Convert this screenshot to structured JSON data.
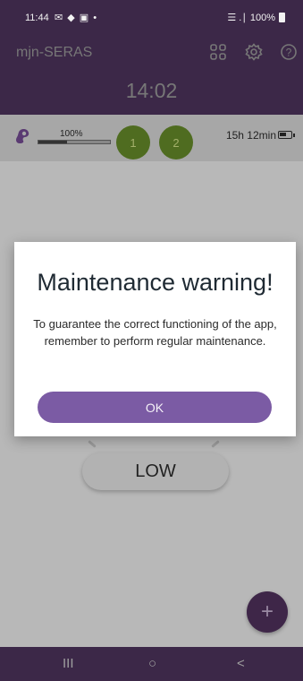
{
  "status_bar": {
    "time": "11:44",
    "notification_icons": "✉ ◆ ▣ •",
    "signal_icons": "☰ .∣",
    "battery_text": "100%"
  },
  "header": {
    "app_title": "mjn-SERAS",
    "clock": "14:02",
    "icons": [
      "apps-icon",
      "settings-icon",
      "help-icon"
    ]
  },
  "device": {
    "volume_label": "100%",
    "volume_level": 0.4,
    "channels": [
      "1",
      "2"
    ],
    "time_left": "15h 12min"
  },
  "main": {
    "mode_label": "LOW",
    "fab_label": "+"
  },
  "dialog": {
    "title": "Maintenance warning!",
    "message": "To guarantee the correct functioning of the app, remember to perform regular maintenance.",
    "ok_label": "OK"
  },
  "nav": {
    "recents": "III",
    "home": "○",
    "back": "<"
  },
  "colors": {
    "primary_dark": "#3c2848",
    "accent": "#7b5ba4",
    "channel_green": "#4f6c20",
    "overlay_gray": "#b8b8b8"
  }
}
